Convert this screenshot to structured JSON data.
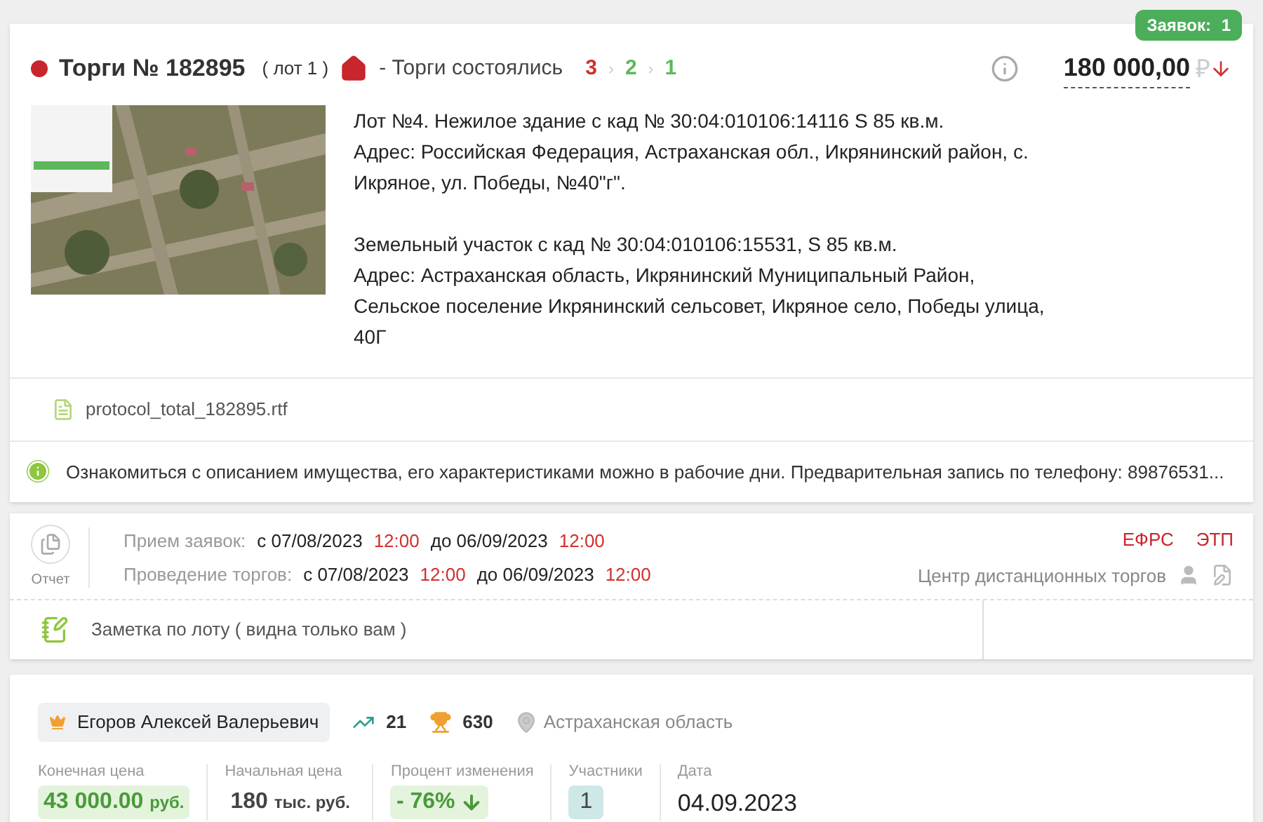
{
  "lot": {
    "bids_badge": "Заявок:",
    "bids_count": "1",
    "title": "Торги № 182895",
    "lot_number": "( лот 1 )",
    "status": "- Торги состоялись",
    "stages": [
      {
        "label": "3",
        "color": "#d0312d"
      },
      {
        "label": "2",
        "color": "#5cb85c"
      },
      {
        "label": "1",
        "color": "#5cb85c"
      }
    ],
    "separator": "›",
    "price": "180 000,00",
    "currency": "₽",
    "image": {
      "kind": "picture"
    },
    "description": [
      [
        "Лот №4. Нежилое здание с кад № 30:04:010106:14116 S 85 кв.м.",
        "Адрес: Российская Федерация, Астраханская обл., Икрянинский район, с. Икряное, ул. Победы, №40\"г\"."
      ],
      [
        "Земельный участок с кад № 30:04:010106:15531, S 85 кв.м.",
        "Адрес: Астраханская область, Икрянинский Муниципальный Район, Сельское поселение Икрянинский сельсовет, Икряное село, Победы улица, 40Г"
      ]
    ],
    "file": "protocol_total_182895.rtf",
    "notice": "Ознакомиться с описанием имущества, его характеристиками можно в рабочие дни. Предварительная запись по телефону: 89876531..."
  },
  "schedule": {
    "report_label": "Отчет",
    "rows": [
      {
        "label": "Прием заявок:",
        "from": "с 07/08/2023",
        "from_time": "12:00",
        "to": "до 06/09/2023",
        "to_time": "12:00"
      },
      {
        "label": "Проведение торгов:",
        "from": "с 07/08/2023",
        "from_time": "12:00",
        "to": "до 06/09/2023",
        "to_time": "12:00"
      }
    ],
    "tags": [
      "ЕФРС",
      "ЭТП"
    ],
    "platform": "Центр дистанционных торгов",
    "note": "Заметка по лоту ( видна только вам )"
  },
  "result": {
    "winner": "Егоров Алексей Валерьевич",
    "rating": "21",
    "trophies": "630",
    "region": "Астраханская область",
    "stats": [
      {
        "kind": "money",
        "label": "Конечная цена",
        "value": "43 000.00",
        "unit": "руб."
      },
      {
        "kind": "plain",
        "label": "Начальная цена",
        "value": "180",
        "unit": "тыс. руб."
      },
      {
        "kind": "change",
        "label": "Процент изменения",
        "value": "- 76%"
      },
      {
        "kind": "count",
        "label": "Участники",
        "value": "1"
      },
      {
        "kind": "date",
        "label": "Дата",
        "value": "04.09.2023"
      }
    ]
  }
}
